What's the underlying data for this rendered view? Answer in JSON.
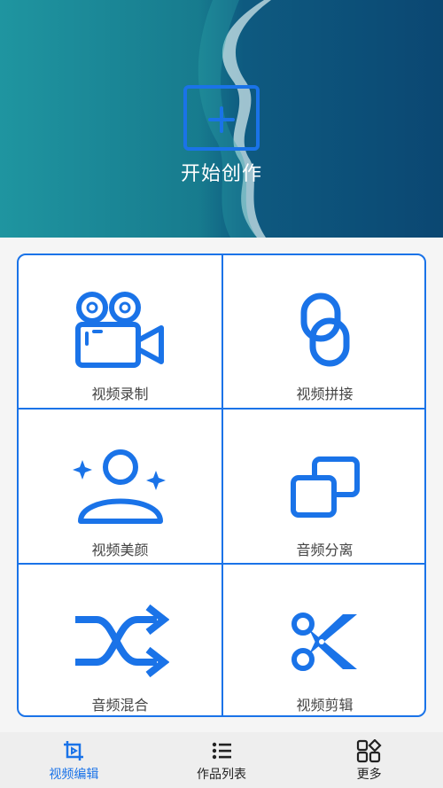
{
  "hero": {
    "create_label": "开始创作"
  },
  "grid": {
    "items": [
      {
        "label": "视频录制",
        "icon": "video-camera-icon"
      },
      {
        "label": "视频拼接",
        "icon": "chain-link-icon"
      },
      {
        "label": "视频美颜",
        "icon": "beauty-person-icon"
      },
      {
        "label": "音频分离",
        "icon": "overlap-squares-icon"
      },
      {
        "label": "音频混合",
        "icon": "shuffle-icon"
      },
      {
        "label": "视频剪辑",
        "icon": "scissors-icon"
      }
    ]
  },
  "nav": {
    "items": [
      {
        "label": "视频编辑",
        "icon": "crop-video-icon",
        "active": true
      },
      {
        "label": "作品列表",
        "icon": "list-icon",
        "active": false
      },
      {
        "label": "更多",
        "icon": "apps-grid-icon",
        "active": false
      }
    ]
  },
  "colors": {
    "accent": "#1a73e8",
    "nav_bg": "#eeeeee",
    "text": "#444444"
  }
}
